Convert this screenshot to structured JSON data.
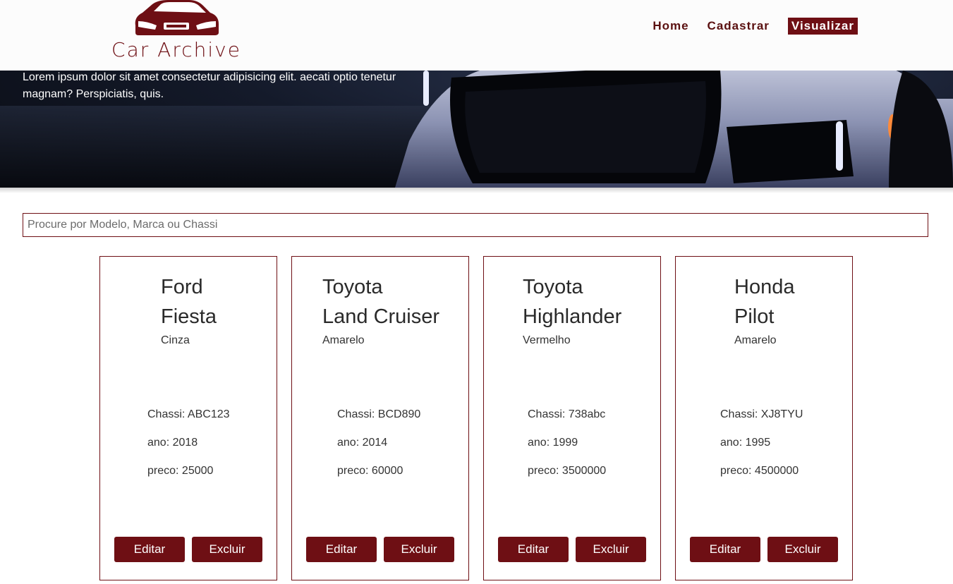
{
  "brand": {
    "name": "Car Archive",
    "color": "#6e0f14",
    "logo_icon": "car-front-icon"
  },
  "nav": [
    {
      "label": "Home",
      "active": false
    },
    {
      "label": "Cadastrar",
      "active": false
    },
    {
      "label": "Visualizar",
      "active": true
    }
  ],
  "hero": {
    "text": "Lorem ipsum dolor sit amet consectetur adipisicing elit. aecati optio tenetur magnam? Perspiciatis, quis."
  },
  "search": {
    "placeholder": "Procure por Modelo, Marca ou Chassi",
    "value": ""
  },
  "cars": [
    {
      "brand": "Ford",
      "model": "Fiesta",
      "color": "Cinza",
      "chassi": "Chassi: ABC123",
      "ano": "ano: 2018",
      "preco": "preco: 25000",
      "edit_label": "Editar",
      "delete_label": "Excluir"
    },
    {
      "brand": "Toyota",
      "model": "Land Cruiser",
      "color": "Amarelo",
      "chassi": "Chassi: BCD890",
      "ano": "ano: 2014",
      "preco": "preco: 60000",
      "edit_label": "Editar",
      "delete_label": "Excluir"
    },
    {
      "brand": "Toyota",
      "model": "Highlander",
      "color": "Vermelho",
      "chassi": "Chassi: 738abc",
      "ano": "ano: 1999",
      "preco": "preco: 3500000",
      "edit_label": "Editar",
      "delete_label": "Excluir"
    },
    {
      "brand": "Honda",
      "model": "Pilot",
      "color": "Amarelo",
      "chassi": "Chassi: XJ8TYU",
      "ano": "ano: 1995",
      "preco": "preco: 4500000",
      "edit_label": "Editar",
      "delete_label": "Excluir"
    }
  ]
}
